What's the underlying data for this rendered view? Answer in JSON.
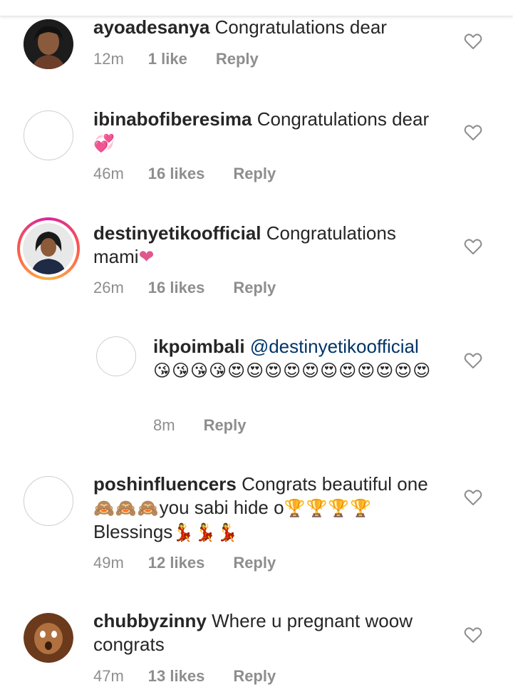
{
  "comments": [
    {
      "username": "ayoadesanya",
      "text": "Congratulations dear",
      "emojis": "",
      "time": "12m",
      "likes": "1 like",
      "reply": "Reply"
    },
    {
      "username": "ibinabofiberesima",
      "text": "Congratulations dear",
      "emojis": "💞",
      "time": "46m",
      "likes": "16 likes",
      "reply": "Reply"
    },
    {
      "username": "destinyetikoofficial",
      "text": "Congratulations mami",
      "emojis": "❤",
      "time": "26m",
      "likes": "16 likes",
      "reply": "Reply"
    },
    {
      "username": "ikpoimbali",
      "text": "@destinyetikoofficial",
      "emojis": "😘😘😘😘😍😍😍😍😍😍😍😍😍😍😍",
      "time": "8m",
      "likes": "",
      "reply": "Reply"
    },
    {
      "username": "poshinfluencers",
      "text": "Congrats beautiful one",
      "emojis_1": "🙈🙈🙈",
      "text_2": "you sabi hide o",
      "emojis_2": "🏆🏆🏆🏆",
      "text_3": "Blessings",
      "emojis_3": "💃💃💃",
      "time": "49m",
      "likes": "12 likes",
      "reply": "Reply"
    },
    {
      "username": "chubbyzinny",
      "text": "Where u pregnant woow congrats",
      "emojis": "",
      "time": "47m",
      "likes": "13 likes",
      "reply": "Reply"
    }
  ],
  "colors": {
    "username": "#262626",
    "meta": "#8e8e8e",
    "mention": "#003569",
    "heart_pink": "#e0578d"
  },
  "icons": {
    "like": "heart-outline-icon"
  }
}
